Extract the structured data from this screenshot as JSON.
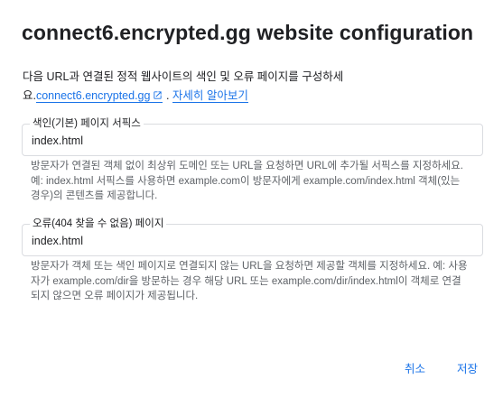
{
  "dialog": {
    "title": "connect6.encrypted.gg website configuration",
    "description_prefix": "다음 URL과 연결된 정적 웹사이트의 색인 및 오류 페이지를 구성하세요.",
    "site_link": "connect6.encrypted.gg",
    "separator": ".",
    "learn_more": "자세히 알아보기"
  },
  "index_field": {
    "label": "색인(기본) 페이지 서픽스",
    "value": "index.html",
    "hint": "방문자가 연결된 객체 없이 최상위 도메인 또는 URL을 요청하면 URL에 추가될 서픽스를 지정하세요. 예: index.html 서픽스를 사용하면 example.com이 방문자에게 example.com/index.html 객체(있는 경우)의 콘텐츠를 제공합니다."
  },
  "error_field": {
    "label": "오류(404 찾을 수 없음) 페이지",
    "value": "index.html",
    "hint": "방문자가 객체 또는 색인 페이지로 연결되지 않는 URL을 요청하면 제공할 객체를 지정하세요. 예: 사용자가 example.com/dir을 방문하는 경우 해당 URL 또는 example.com/dir/index.html이 객체로 연결되지 않으면 오류 페이지가 제공됩니다."
  },
  "actions": {
    "cancel_label": "취소",
    "save_label": "저장"
  },
  "icons": {
    "external_link": "open-in-new-icon"
  },
  "colors": {
    "accent": "#1a73e8",
    "text": "#202124",
    "secondary_text": "#5f6368",
    "border": "#dadce0"
  }
}
